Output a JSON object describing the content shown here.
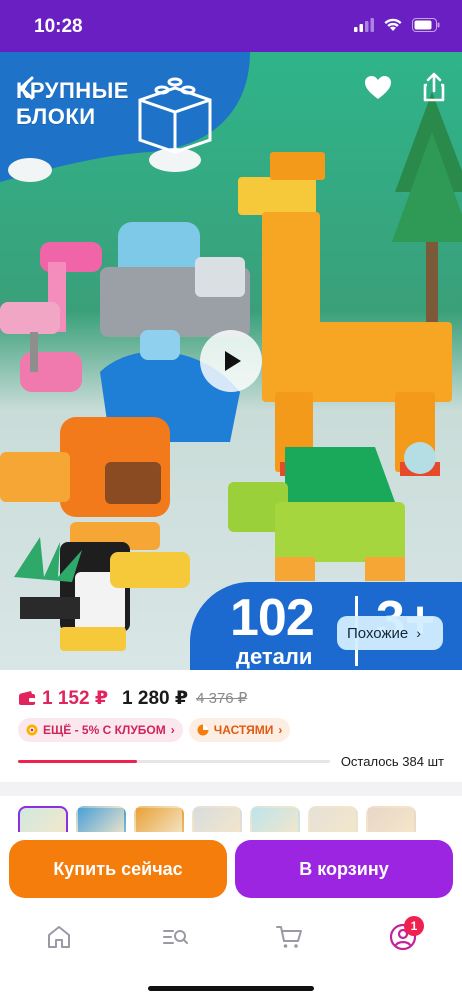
{
  "status_bar": {
    "time": "10:28"
  },
  "hero": {
    "title_line1": "КРУПНЫЕ",
    "title_line2": "БЛОКИ",
    "promo_number": "102",
    "promo_label": "детали",
    "promo_age": "3+",
    "similar_label": "Похожие",
    "gallery_dots": 5,
    "gallery_active_index": 0
  },
  "price": {
    "card_price": "1 152 ₽",
    "price": "1 280 ₽",
    "old_price": "4 376 ₽"
  },
  "chips": [
    {
      "label": "ЕЩЁ - 5% С КЛУБОМ"
    },
    {
      "label": "ЧАСТЯМИ"
    }
  ],
  "stock": {
    "text": "Осталось 384 шт",
    "fill_fraction": 0.38
  },
  "thumbnails_count": 7,
  "actions": {
    "buy_now": "Купить сейчас",
    "add_to_cart": "В корзину"
  },
  "tabbar": {
    "profile_badge": "1"
  },
  "colors": {
    "status_bar": "#6a1fc2",
    "buy_now": "#f57d0c",
    "add_to_cart": "#9b25e0",
    "accent_price": "#e0245e",
    "promo_badge": "#1c6ad0"
  },
  "icons": [
    "back-arrow-icon",
    "heart-icon",
    "share-icon",
    "play-icon",
    "wallet-icon",
    "gift-icon",
    "installments-icon",
    "home-icon",
    "catalog-search-icon",
    "cart-icon",
    "profile-icon"
  ]
}
